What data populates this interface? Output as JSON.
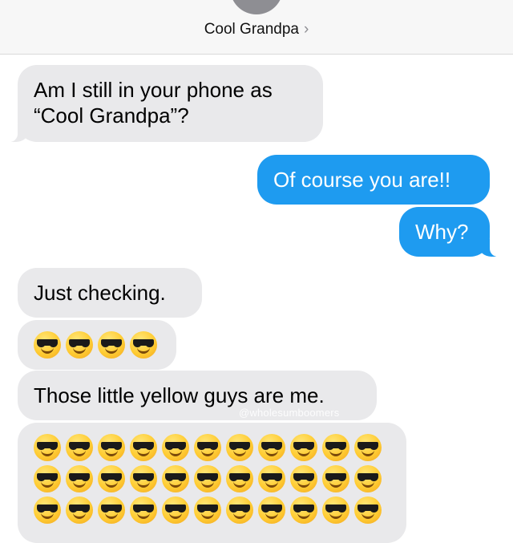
{
  "header": {
    "contact_name": "Cool Grandpa",
    "chevron": "›",
    "avatar_icon": "contact-avatar-icon"
  },
  "messages": [
    {
      "direction": "incoming",
      "text": "Am I still in your phone as “Cool Grandpa”?"
    },
    {
      "direction": "outgoing",
      "text": "Of course you are!!"
    },
    {
      "direction": "outgoing",
      "text": "Why?"
    },
    {
      "direction": "incoming",
      "text": "Just checking."
    },
    {
      "direction": "incoming",
      "emoji": "smiling-face-with-sunglasses",
      "emoji_count": 4
    },
    {
      "direction": "incoming",
      "text": "Those little yellow guys are me."
    },
    {
      "direction": "incoming",
      "emoji": "smiling-face-with-sunglasses",
      "emoji_count": 33
    }
  ],
  "watermark": "@wholesumboomers",
  "colors": {
    "incoming_bubble": "#e9e9eb",
    "outgoing_bubble": "#1e9bf0",
    "header_bg": "#f7f7f7"
  }
}
